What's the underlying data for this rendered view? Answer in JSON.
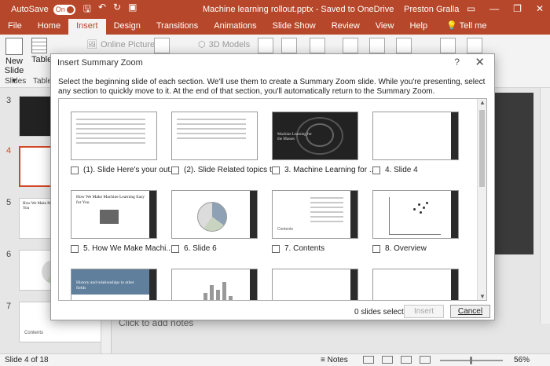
{
  "titlebar": {
    "autosave_label": "AutoSave",
    "autosave_state": "On",
    "document_title": "Machine learning rollout.pptx - Saved to OneDrive",
    "user_name": "Preston Gralla"
  },
  "ribbon_tabs": [
    "File",
    "Home",
    "Insert",
    "Design",
    "Transitions",
    "Animations",
    "Slide Show",
    "Review",
    "View",
    "Help"
  ],
  "active_tab": "Insert",
  "tell_me": "Tell me",
  "ribbon": {
    "new_slide_label": "New",
    "new_slide_label2": "Slide",
    "slides_group": "Slides",
    "table_label": "Table",
    "tables_group": "Tables",
    "online_pictures": "Online Pictures",
    "models_3d": "3D Models"
  },
  "slide_pane": {
    "numbers": [
      "3",
      "4",
      "5",
      "6",
      "7"
    ],
    "thumb5_title": "How We Make Machine Learning Easy for You",
    "thumb7_label": "Contents"
  },
  "canvas": {
    "notes_placeholder": "Click to add notes"
  },
  "status": {
    "slide_info": "Slide 4 of 18",
    "notes_label": "Notes",
    "zoom_value": "56%"
  },
  "dialog": {
    "title": "Insert Summary Zoom",
    "help_label": "?",
    "close_label": "✕",
    "instructions": "Select the beginning slide of each section. We'll use them to create a Summary Zoom slide. While you're presenting, select any section to quickly move to it. At the end of that section, you'll automatically return to the Summary Zoom.",
    "slides": [
      {
        "label": "(1). Slide Here's your out...",
        "style": "text"
      },
      {
        "label": "(2). Slide Related topics t...",
        "style": "text"
      },
      {
        "label": "3. Machine Learning for ...",
        "style": "dark",
        "thumb_title": "Machine Learning for the Masses"
      },
      {
        "label": "4. Slide 4",
        "style": "blank"
      },
      {
        "label": "5. How We Make Machi...",
        "style": "photo",
        "thumb_title": "How We Make Machine Learning Easy for You"
      },
      {
        "label": "6. Slide 6",
        "style": "pie"
      },
      {
        "label": "7. Contents",
        "style": "list",
        "thumb_title": "Contents"
      },
      {
        "label": "8. Overview",
        "style": "scatter"
      },
      {
        "label": "",
        "style": "blue",
        "thumb_title": "History and relationships to other fields"
      },
      {
        "label": "",
        "style": "bars"
      },
      {
        "label": "",
        "style": "blank"
      },
      {
        "label": "",
        "style": "blank"
      }
    ],
    "selected_count": "0 slides selected",
    "insert_label": "Insert",
    "cancel_label": "Cancel"
  }
}
